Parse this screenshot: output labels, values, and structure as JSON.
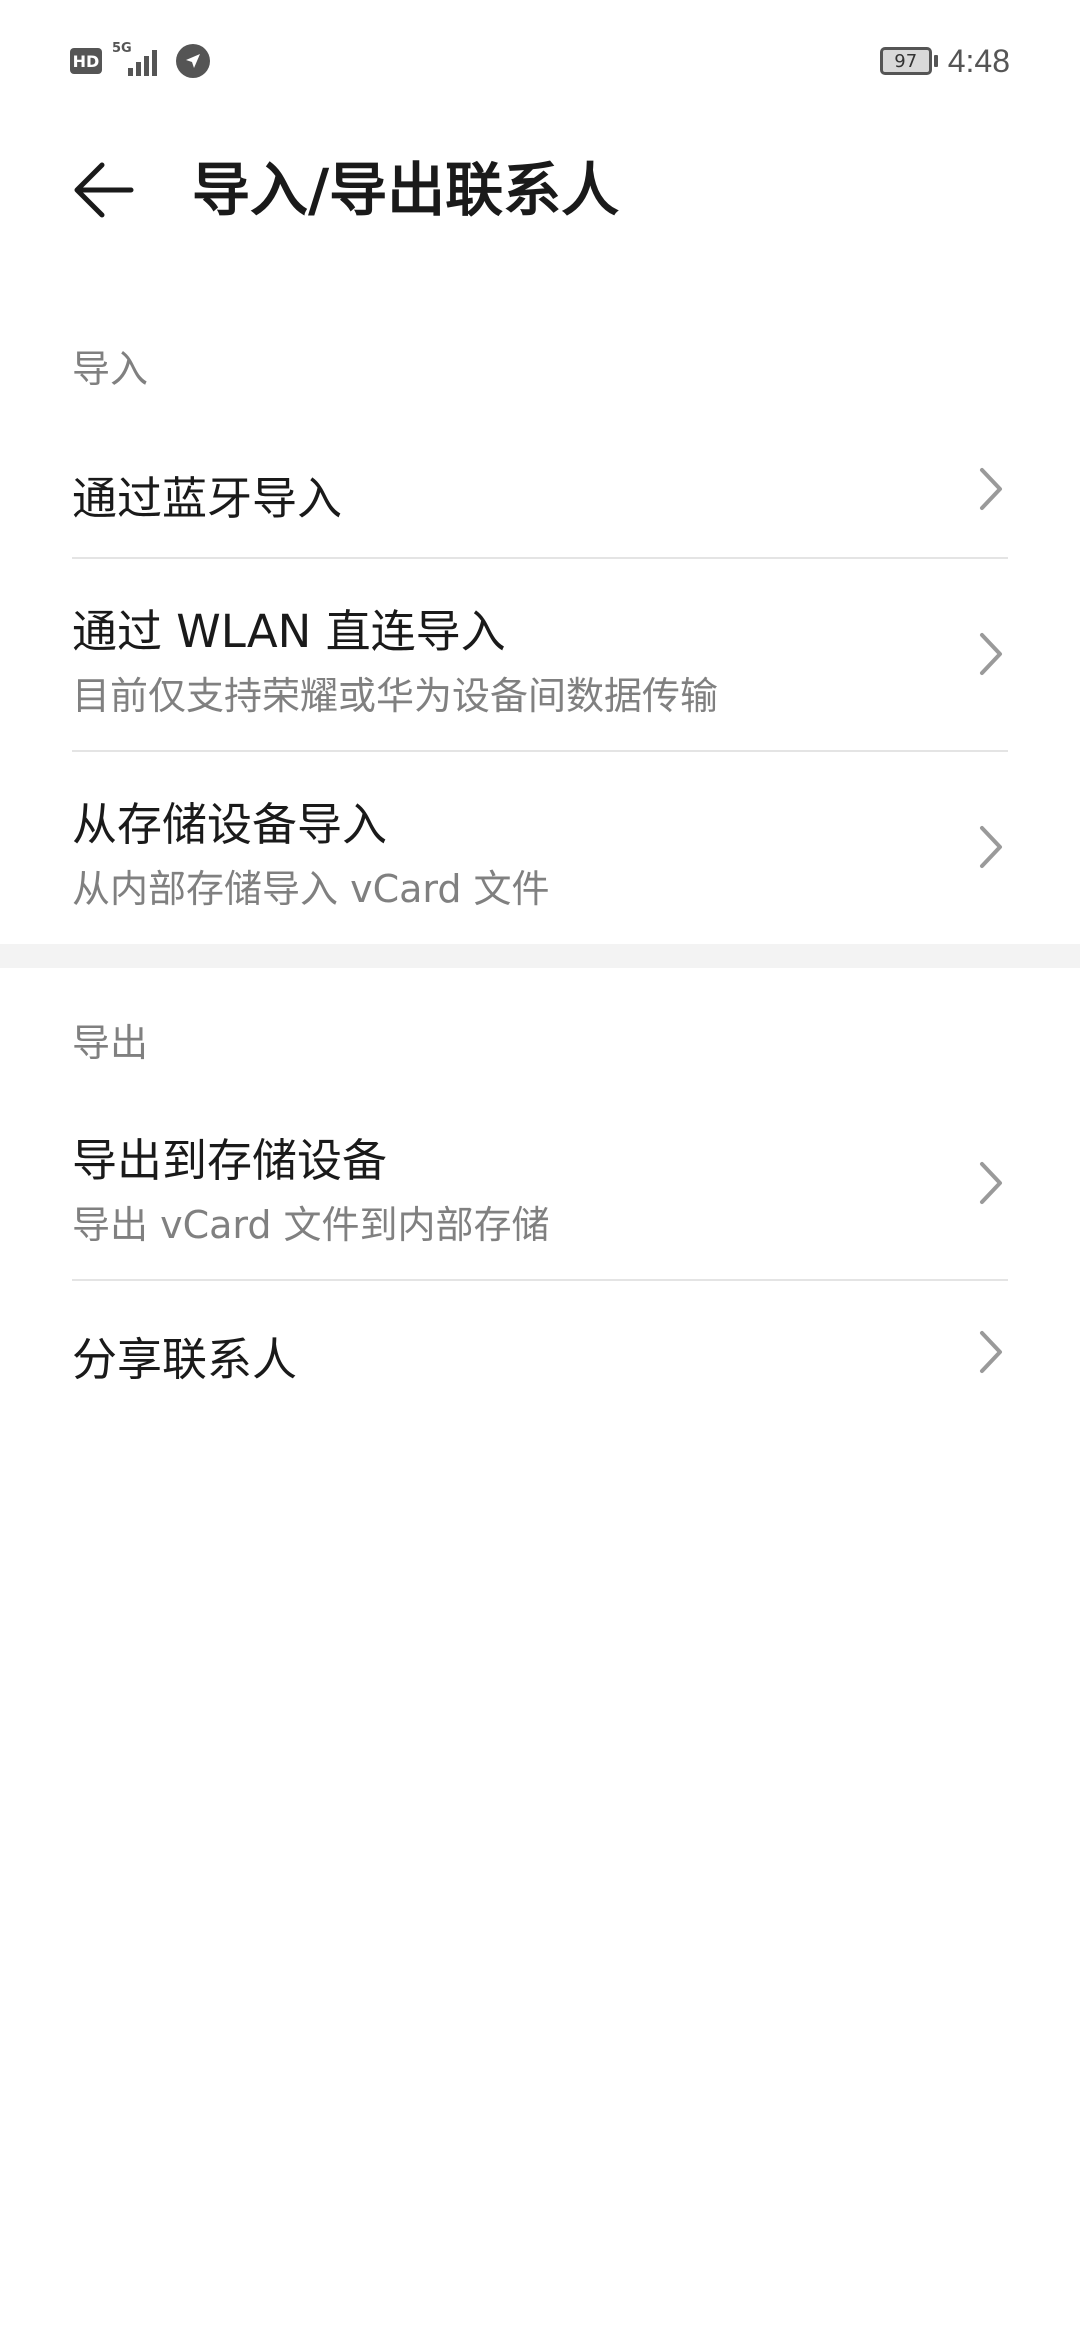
{
  "status_bar": {
    "hd_label": "HD",
    "network_label": "5G",
    "battery_level": "97",
    "time": "4:48",
    "icons": [
      "hd-icon",
      "signal-icon",
      "navigation-icon",
      "battery-icon"
    ]
  },
  "header": {
    "title": "导入/导出联系人",
    "back_icon": "back-arrow-icon"
  },
  "import_section": {
    "label": "导入",
    "items": [
      {
        "title": "通过蓝牙导入",
        "subtitle": ""
      },
      {
        "title": "通过 WLAN 直连导入",
        "subtitle": "目前仅支持荣耀或华为设备间数据传输"
      },
      {
        "title": "从存储设备导入",
        "subtitle": "从内部存储导入 vCard 文件"
      }
    ]
  },
  "export_section": {
    "label": "导出",
    "items": [
      {
        "title": "导出到存储设备",
        "subtitle": "导出 vCard 文件到内部存储"
      },
      {
        "title": "分享联系人",
        "subtitle": ""
      }
    ]
  },
  "colors": {
    "primary_text": "#1a1a1a",
    "secondary_text": "#808080",
    "divider": "#e4e4e4",
    "section_gap": "#f3f3f3",
    "chevron": "#9a9a9a"
  }
}
